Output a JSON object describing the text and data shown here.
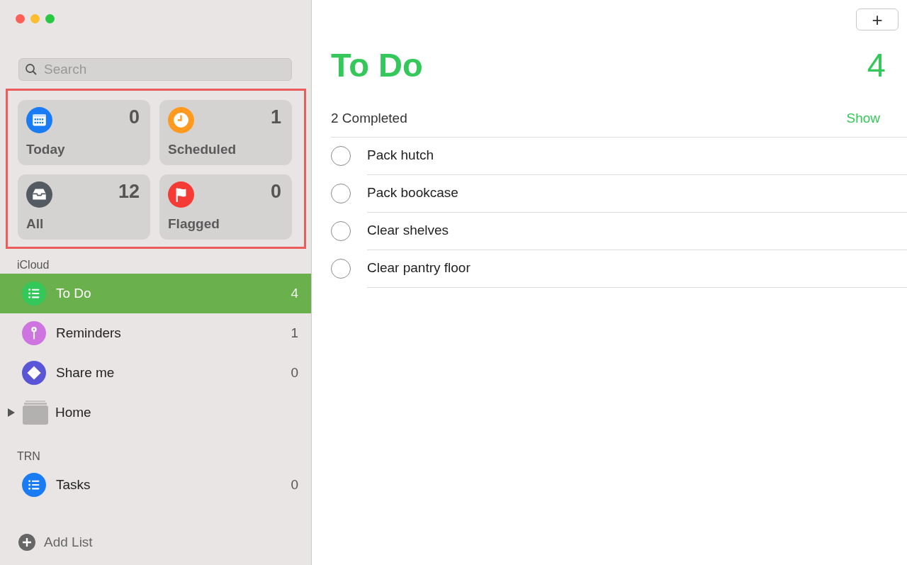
{
  "search": {
    "placeholder": "Search"
  },
  "smart_lists": [
    {
      "kind": "calendar",
      "name": "Today",
      "count": "0",
      "color": "#1a7cf5"
    },
    {
      "kind": "clock",
      "name": "Scheduled",
      "count": "1",
      "color": "#ff9a1f"
    },
    {
      "kind": "tray",
      "name": "All",
      "count": "12",
      "color": "#545a62"
    },
    {
      "kind": "flag",
      "name": "Flagged",
      "count": "0",
      "color": "#f53b35"
    }
  ],
  "sections": [
    {
      "title": "iCloud",
      "lists": [
        {
          "kind": "list",
          "name": "To Do",
          "count": "4",
          "color": "#34c759",
          "selected": true
        },
        {
          "kind": "pin",
          "name": "Reminders",
          "count": "1",
          "color": "#cd74e0",
          "selected": false
        },
        {
          "kind": "diamond",
          "name": "Share me",
          "count": "0",
          "color": "#5a55d6",
          "selected": false
        },
        {
          "kind": "group",
          "name": "Home",
          "expanded": false,
          "selected": false
        }
      ]
    },
    {
      "title": "TRN",
      "lists": [
        {
          "kind": "list",
          "name": "Tasks",
          "count": "0",
          "color": "#1a7cf5",
          "selected": false
        }
      ]
    }
  ],
  "add_list": "Add List",
  "add_button": "+",
  "main": {
    "title": "To Do",
    "count": "4",
    "completed": "2 Completed",
    "show": "Show",
    "tasks": [
      {
        "title": "Pack hutch",
        "done": false
      },
      {
        "title": "Pack bookcase",
        "done": false
      },
      {
        "title": "Clear shelves",
        "done": false
      },
      {
        "title": "Clear pantry floor",
        "done": false
      }
    ]
  }
}
